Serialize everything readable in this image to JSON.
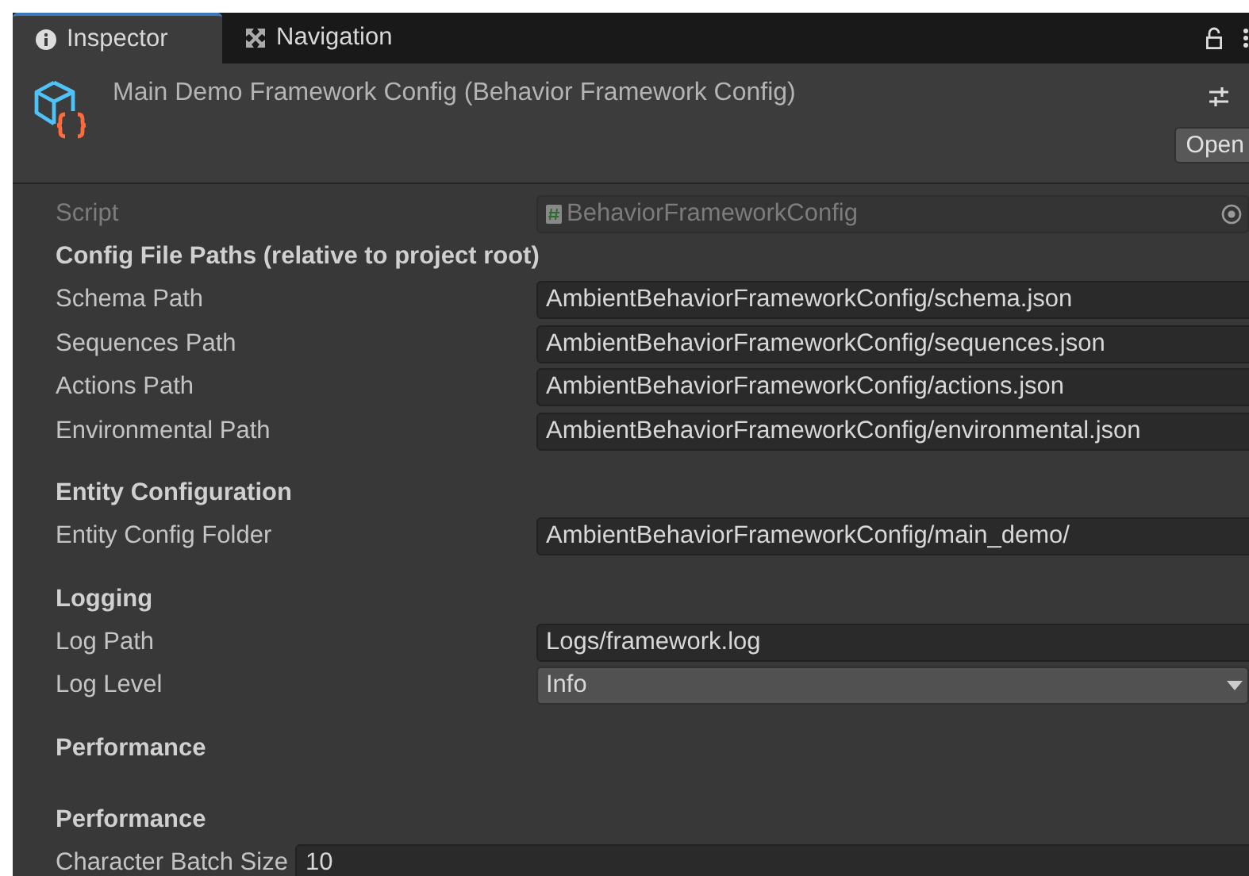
{
  "tabs": [
    {
      "label": "Inspector",
      "kind": "info",
      "selected": true
    },
    {
      "label": "Navigation",
      "kind": "navigation",
      "selected": false
    }
  ],
  "header": {
    "title": "Main Demo Framework Config (Behavior Framework Config)",
    "button": "Open"
  },
  "rows": [
    {
      "kind": "object_field",
      "label": "Script",
      "value": "BehaviorFrameworkConfig",
      "disabled": true
    },
    {
      "kind": "header",
      "label": "Config File Paths (relative to project root)"
    },
    {
      "kind": "text_field",
      "label": "Schema Path",
      "value": "AmbientBehaviorFrameworkConfig/schema.json"
    },
    {
      "kind": "text_field",
      "label": "Sequences Path",
      "value": "AmbientBehaviorFrameworkConfig/sequences.json"
    },
    {
      "kind": "text_field",
      "label": "Actions Path",
      "value": "AmbientBehaviorFrameworkConfig/actions.json"
    },
    {
      "kind": "text_field",
      "label": "Environmental Path",
      "value": "AmbientBehaviorFrameworkConfig/environmental.json"
    },
    {
      "kind": "header",
      "label": "Entity Configuration"
    },
    {
      "kind": "text_field",
      "label": "Entity Config Folder",
      "value": "AmbientBehaviorFrameworkConfig/main_demo/"
    },
    {
      "kind": "header",
      "label": "Logging"
    },
    {
      "kind": "text_field",
      "label": "Log Path",
      "value": "Logs/framework.log"
    },
    {
      "kind": "dropdown",
      "label": "Log Level",
      "value": "Info"
    },
    {
      "kind": "header",
      "label": "Performance"
    },
    {
      "kind": "header",
      "label": "Performance"
    },
    {
      "kind": "inline_field",
      "label": "Character Batch Size",
      "value": "10"
    }
  ]
}
